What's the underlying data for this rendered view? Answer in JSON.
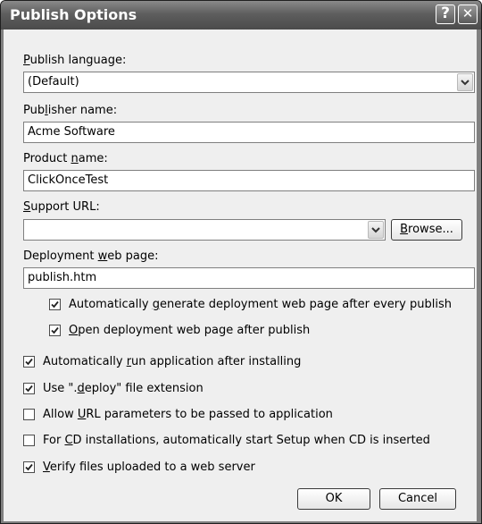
{
  "window": {
    "title": "Publish Options",
    "help_glyph": "?",
    "close_glyph": "✕"
  },
  "publish_language": {
    "label_pre": "",
    "label_key": "P",
    "label_post": "ublish language:",
    "value": "(Default)"
  },
  "publisher_name": {
    "label_pre": "Pub",
    "label_key": "l",
    "label_post": "isher name:",
    "value": "Acme Software"
  },
  "product_name": {
    "label_pre": "Product ",
    "label_key": "n",
    "label_post": "ame:",
    "value": "ClickOnceTest"
  },
  "support_url": {
    "label_pre": "",
    "label_key": "S",
    "label_post": "upport URL:",
    "value": "",
    "browse_pre": "",
    "browse_key": "B",
    "browse_post": "rowse..."
  },
  "deployment_page": {
    "label_pre": "Deployment ",
    "label_key": "w",
    "label_post": "eb page:",
    "value": "publish.htm"
  },
  "options": [
    {
      "pre": "Automatically ",
      "key": "g",
      "post": "enerate deployment web page after every publish",
      "checked": true
    },
    {
      "pre": "",
      "key": "O",
      "post": "pen deployment web page after publish",
      "checked": true
    },
    {
      "pre": "Automatically ",
      "key": "r",
      "post": "un application after installing",
      "checked": true
    },
    {
      "pre": "Use \".",
      "key": "d",
      "post": "eploy\" file extension",
      "checked": true
    },
    {
      "pre": "Allow ",
      "key": "U",
      "post": "RL parameters to be passed to application",
      "checked": false
    },
    {
      "pre": "For ",
      "key": "C",
      "post": "D installations, automatically start Setup when CD is inserted",
      "checked": false
    },
    {
      "pre": "",
      "key": "V",
      "post": "erify files uploaded to a web server",
      "checked": true
    }
  ],
  "buttons": {
    "ok": "OK",
    "cancel": "Cancel"
  },
  "icons": {
    "help": "help-icon",
    "close": "close-icon",
    "dropdown": "chevron-down-icon",
    "check": "checkmark-icon"
  },
  "colors": {
    "titlebar": "#5e5e5e",
    "client": "#efefef",
    "border": "#1f1f1f"
  }
}
